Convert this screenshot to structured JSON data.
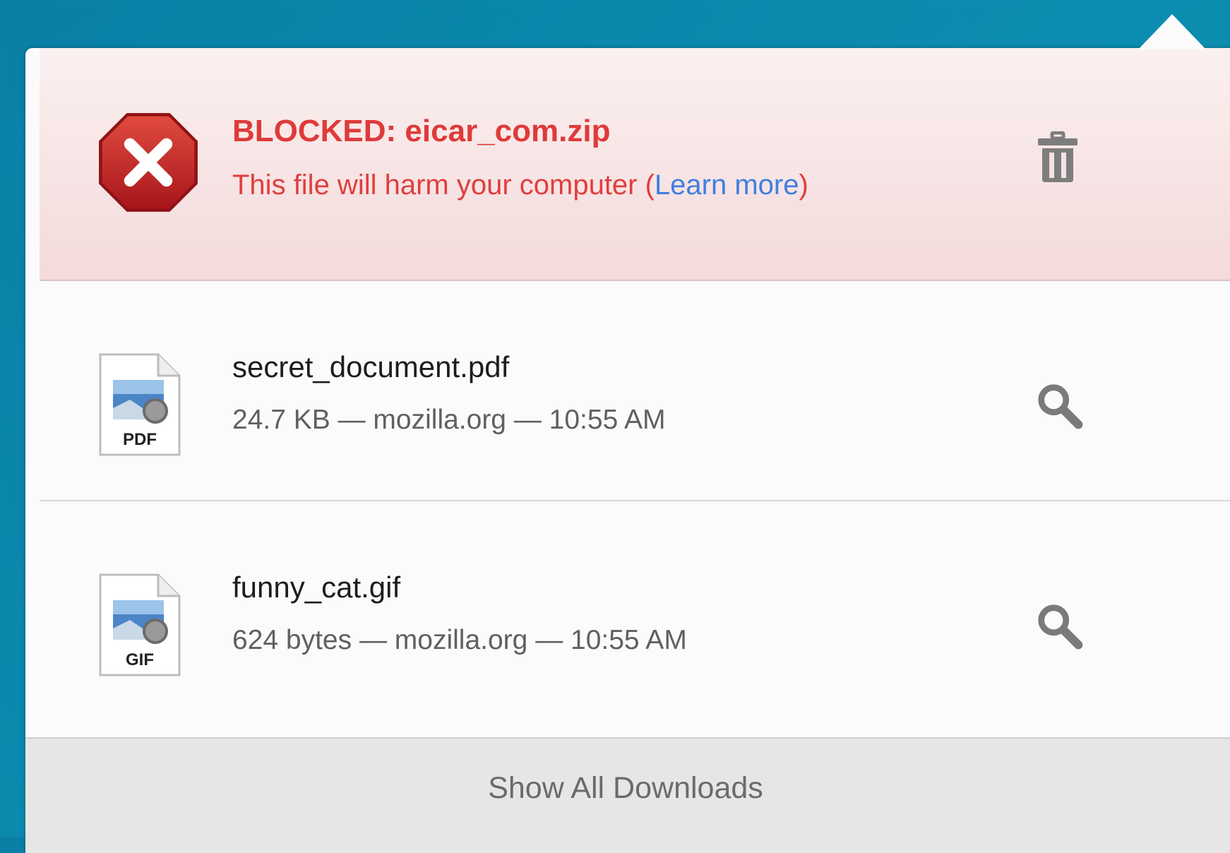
{
  "downloads_panel": {
    "blocked_item": {
      "title": "BLOCKED: eicar_com.zip",
      "message_prefix": "This file will harm your computer (",
      "learn_more_label": "Learn more",
      "message_suffix": ")",
      "action_icon": "trash-icon",
      "status_icon": "stop-icon"
    },
    "items": [
      {
        "name": "secret_document.pdf",
        "meta": "24.7 KB — mozilla.org — 10:55 AM",
        "file_type": "PDF",
        "action_icon": "search-icon"
      },
      {
        "name": "funny_cat.gif",
        "meta": "624 bytes — mozilla.org — 10:55 AM",
        "file_type": "GIF",
        "action_icon": "search-icon"
      }
    ],
    "footer_label": "Show All Downloads"
  },
  "colors": {
    "blocked_text": "#df3a3a",
    "link": "#3f7fe0",
    "background_teal": "#0b8aae"
  }
}
